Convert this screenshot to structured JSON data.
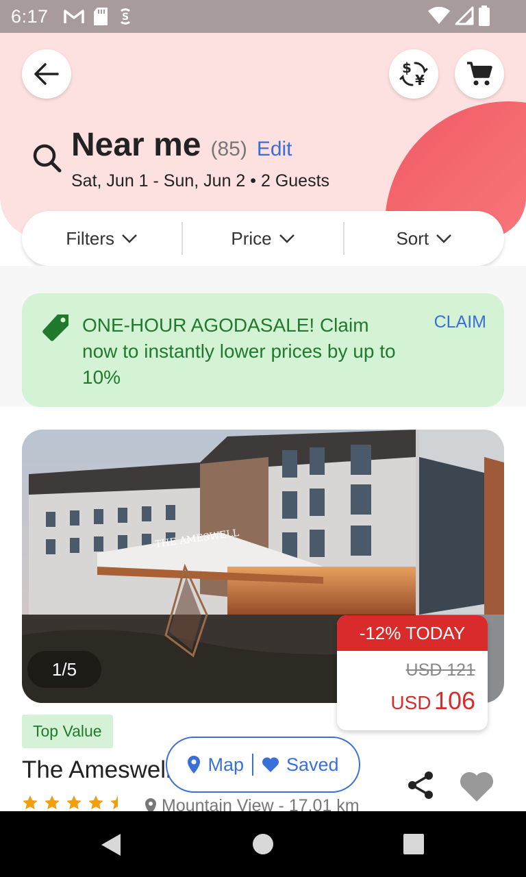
{
  "status_bar": {
    "time": "6:17"
  },
  "header": {
    "title": "Near me",
    "count": "(85)",
    "edit_label": "Edit",
    "subtitle": "Sat, Jun 1 - Sun, Jun 2 • 2 Guests"
  },
  "filters": {
    "filters_label": "Filters",
    "price_label": "Price",
    "sort_label": "Sort"
  },
  "promo": {
    "text": "ONE-HOUR AGODASALE! Claim now to instantly lower prices by up to 10%",
    "claim_label": "CLAIM"
  },
  "hotel": {
    "photo_counter": "1/5",
    "discount_label": "-12% TODAY",
    "old_price": "USD 121",
    "price_currency": "USD",
    "price_value": "106",
    "badge": "Top Value",
    "name": "The Ameswell",
    "rating": 4.5,
    "location": "Mountain View - 17.01 km",
    "sign_text": "THE AMESWELL"
  },
  "bottom_pill": {
    "map_label": "Map",
    "saved_label": "Saved"
  },
  "colors": {
    "accent_blue": "#3b6fd8",
    "sale_red": "#d92b2b",
    "promo_green": "#1f7a2e",
    "header_pink": "#fde0e0"
  }
}
